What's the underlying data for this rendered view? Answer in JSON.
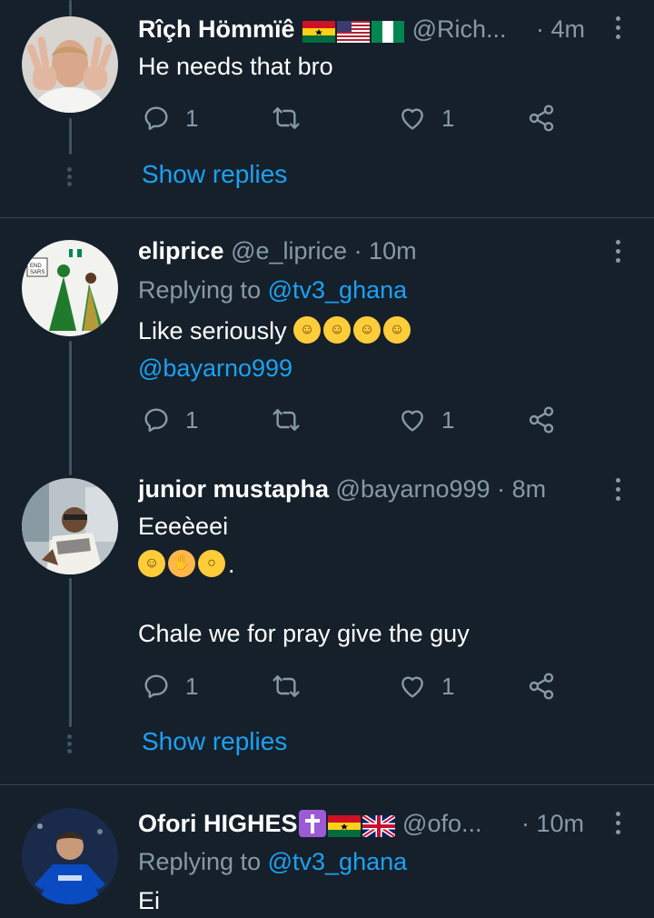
{
  "tweets": [
    {
      "name": "Rîçh Hömmïê",
      "flags": [
        "Ghana",
        "USA",
        "Nigeria"
      ],
      "handle": "@Rich...",
      "time": "· 4m",
      "text": "He needs that bro",
      "replies": "1",
      "retweets": "",
      "likes": "1",
      "show_replies": "Show replies"
    },
    {
      "name": "eliprice",
      "handle": "@e_liprice",
      "time": "· 10m",
      "replying_prefix": "Replying to",
      "replying_to": "@tv3_ghana",
      "text": "Like seriously",
      "emojis": [
        "rolling-on-floor-laughing",
        "rolling-on-floor-laughing",
        "rolling-on-floor-laughing",
        "rolling-on-floor-laughing"
      ],
      "mention": "@bayarno999",
      "replies": "1",
      "retweets": "",
      "likes": "1"
    },
    {
      "name": "junior mustapha",
      "handle": "@bayarno999",
      "time": "· 8m",
      "text": "Eeeèeei",
      "emojis": [
        "tears-of-joy",
        "facepalm",
        "astonished"
      ],
      "emoji_suffix": ".",
      "text2": "Chale we for pray give the guy",
      "replies": "1",
      "retweets": "",
      "likes": "1",
      "show_replies": "Show replies"
    },
    {
      "name": "Ofori HIGHES",
      "flags": [
        "Latin-cross",
        "Ghana",
        "UK"
      ],
      "handle": "@ofo...",
      "time": "· 10m",
      "replying_prefix": "Replying to",
      "replying_to": "@tv3_ghana",
      "text": "Ei"
    }
  ],
  "colors": {
    "background": "#15202b",
    "accent": "#1da1f2",
    "muted": "#8899a6",
    "divider": "#38444d"
  }
}
